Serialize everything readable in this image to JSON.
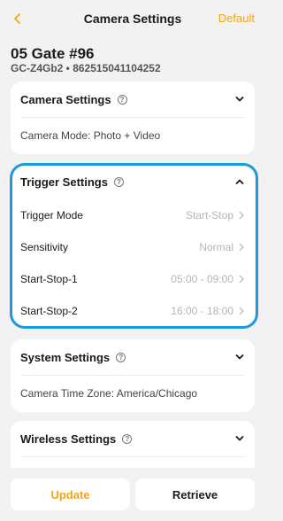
{
  "colors": {
    "accent": "#f2a51a",
    "highlight": "#1a9be0",
    "background": "#f2f2f2"
  },
  "nav": {
    "title": "Camera Settings",
    "default_label": "Default",
    "back_icon": "chevron-left-icon"
  },
  "device": {
    "name": "05 Gate #96",
    "id_line": "GC-Z4Gb2 • 862515041104252"
  },
  "camera_settings": {
    "title": "Camera Settings",
    "mode_text": "Camera Mode: Photo + Video"
  },
  "trigger_settings": {
    "title": "Trigger Settings",
    "rows": [
      {
        "label": "Trigger Mode",
        "value": "Start-Stop"
      },
      {
        "label": "Sensitivity",
        "value": "Normal"
      },
      {
        "label": "Start-Stop-1",
        "value": "05:00 - 09:00"
      },
      {
        "label": "Start-Stop-2",
        "value": "16:00 - 18:00"
      }
    ]
  },
  "system_settings": {
    "title": "System Settings",
    "timezone_text": "Camera Time Zone: America/Chicago"
  },
  "wireless_settings": {
    "title": "Wireless Settings"
  },
  "actions": {
    "update_label": "Update",
    "retrieve_label": "Retrieve"
  }
}
